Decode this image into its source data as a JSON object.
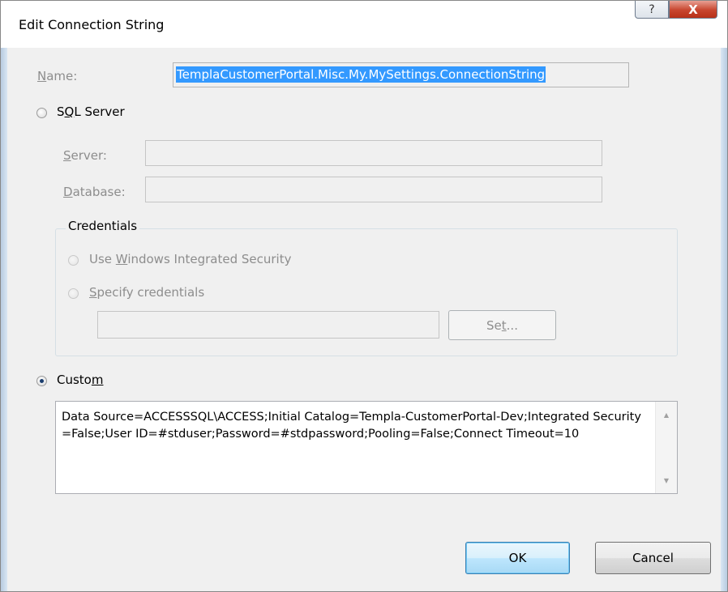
{
  "window": {
    "title": "Edit Connection String",
    "help_label": "?",
    "close_label": "X"
  },
  "name": {
    "label_prefix": "",
    "label_ul": "N",
    "label_rest": "ame:",
    "value": "TemplaCustomerPortal.Misc.My.MySettings.ConnectionString"
  },
  "sql_server": {
    "label_pre": "S",
    "label_ul": "Q",
    "label_rest": "L Server",
    "selected": false,
    "server_label_ul": "S",
    "server_label_rest": "erver:",
    "server_value": "",
    "database_label_ul": "D",
    "database_label_rest": "atabase:",
    "database_value": ""
  },
  "credentials": {
    "legend": "Credentials",
    "windows_pre": "Use ",
    "windows_ul": "W",
    "windows_rest": "indows Integrated Security",
    "specify_ul": "S",
    "specify_rest": "pecify credentials",
    "credential_value": "",
    "set_pre": "Se",
    "set_ul": "t",
    "set_rest": "..."
  },
  "custom": {
    "label_pre": "Custo",
    "label_ul": "m",
    "selected": true,
    "connection_string": "Data Source=ACCESSSQL\\ACCESS;Initial Catalog=Templa-CustomerPortal-Dev;Integrated Security=False;User ID=#stduser;Password=#stdpassword;Pooling=False;Connect Timeout=10"
  },
  "buttons": {
    "ok": "OK",
    "cancel": "Cancel"
  },
  "colors": {
    "selection": "#3399ff",
    "close_button": "#c7452e",
    "disabled_text": "#8d8d8d"
  }
}
